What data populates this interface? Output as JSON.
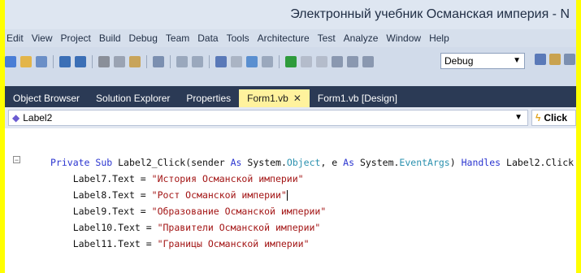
{
  "window": {
    "title": "Электронный учебник Османская империя - N"
  },
  "menu": [
    "Edit",
    "View",
    "Project",
    "Build",
    "Debug",
    "Team",
    "Data",
    "Tools",
    "Architecture",
    "Test",
    "Analyze",
    "Window",
    "Help"
  ],
  "toolbar": {
    "config": "Debug"
  },
  "tabs": [
    {
      "label": "Object Browser",
      "active": false
    },
    {
      "label": "Solution Explorer",
      "active": false
    },
    {
      "label": "Properties",
      "active": false
    },
    {
      "label": "Form1.vb",
      "active": true
    },
    {
      "label": "Form1.vb [Design]",
      "active": false
    }
  ],
  "navbar": {
    "object": "Label2",
    "event": "Click"
  },
  "code": {
    "sig": {
      "private": "Private",
      "sub": "Sub",
      "name": "Label2_Click(sender",
      "as1": "As",
      "sys1": "System.",
      "object": "Object",
      "comma": ", e",
      "as2": "As",
      "sys2": "System.",
      "eventargs": "EventArgs",
      "close": ")",
      "handles": "Handles",
      "target": "Label2.Click"
    },
    "lines": [
      {
        "lhs": "Label7.Text = ",
        "str": "\"История Османской империи\""
      },
      {
        "lhs": "Label8.Text = ",
        "str": "\"Рост Османской империи\""
      },
      {
        "lhs": "Label9.Text = ",
        "str": "\"Образование Османской империи\""
      },
      {
        "lhs": "Label10.Text = ",
        "str": "\"Правители Османской империи\""
      },
      {
        "lhs": "Label11.Text = ",
        "str": "\"Границы Османской империи\""
      }
    ]
  }
}
